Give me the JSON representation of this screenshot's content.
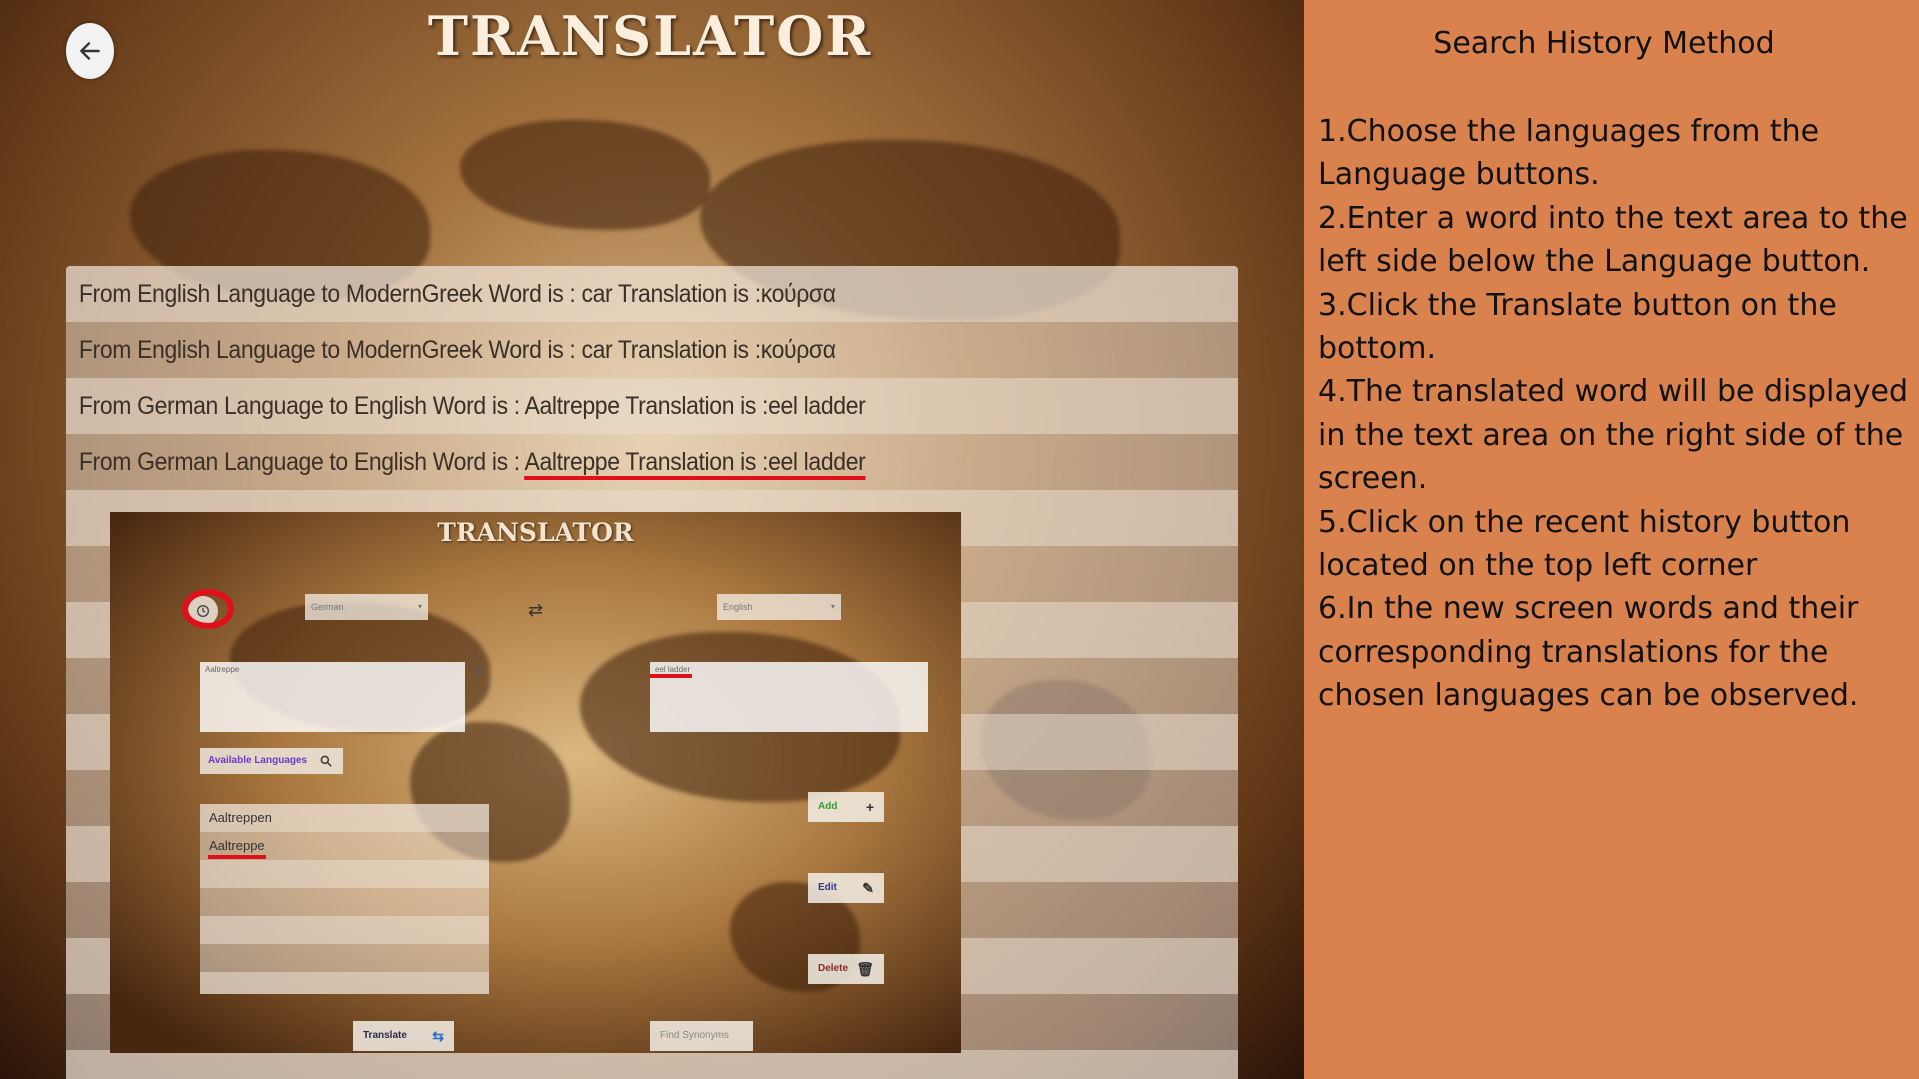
{
  "app": {
    "title": "TRANSLATOR",
    "history": [
      "From English Language to ModernGreek Word is : car Translation is :κούρσα",
      "From English Language to ModernGreek Word is : car Translation is :κούρσα",
      "From German Language to English Word is : Aaltreppe Translation is :eel ladder",
      {
        "prefix": "From German Language to English Word is : ",
        "highlight": "Aaltreppe Translation is :eel ladder"
      }
    ],
    "inner": {
      "title": "TRANSLATOR",
      "source_lang": "German",
      "target_lang": "English",
      "input_text": "Aaltreppe",
      "output_text": "eel ladder",
      "available_languages_label": "Available Languages",
      "list_items": [
        "Aaltreppen",
        "Aaltreppe"
      ],
      "add_label": "Add",
      "edit_label": "Edit",
      "delete_label": "Delete",
      "translate_label": "Translate",
      "find_synonyms_label": "Find Synonyms"
    }
  },
  "panel": {
    "title": "Search History Method",
    "steps": [
      "1.Choose the languages from the Language buttons.",
      "2.Enter a word into the text area to the left side below the Language button.",
      "3.Click the Translate button on the bottom.",
      "4.The translated word will be displayed in the text area on the right side of the screen.",
      "5.Click on the recent history button located on the top left corner",
      "6.In the new screen words and their corresponding translations for the chosen languages can be observed."
    ]
  },
  "colors": {
    "panel_bg": "#d9824e",
    "highlight": "#e0101a"
  },
  "icons": [
    "back-arrow-icon",
    "history-icon",
    "swap-icon",
    "close-icon",
    "search-icon",
    "plus-icon",
    "pencil-icon",
    "trash-icon",
    "translate-icon"
  ]
}
